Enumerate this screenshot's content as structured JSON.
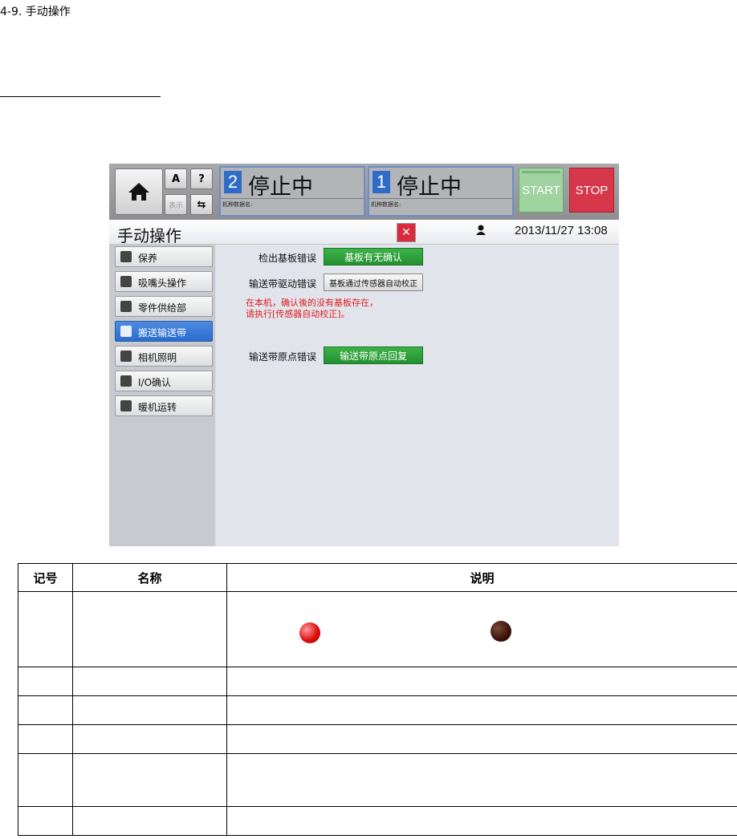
{
  "doc": {
    "heading": "4-9. 手动操作"
  },
  "hmi": {
    "home_icon": "home-icon",
    "buttons_small": [
      "A",
      "?",
      "表示",
      "⇆"
    ],
    "status": [
      {
        "num": "2",
        "text": "停止中",
        "sub": "机种数据名:"
      },
      {
        "num": "1",
        "text": "停止中",
        "sub": "机种数据名:"
      }
    ],
    "start_label": "START",
    "stop_label": "STOP",
    "page_title": "手动操作",
    "datetime": "2013/11/27 13:08",
    "sidebar": [
      {
        "label": "保养",
        "active": false
      },
      {
        "label": "吸嘴头操作",
        "active": false
      },
      {
        "label": "零件供给部",
        "active": false
      },
      {
        "label": "搬送输送带",
        "active": true
      },
      {
        "label": "相机照明",
        "active": false
      },
      {
        "label": "I/O确认",
        "active": false
      },
      {
        "label": "暖机运转",
        "active": false
      }
    ],
    "rows": {
      "r1_label": "检出基板错误",
      "r1_button": "基板有无确认",
      "r2_label": "输送带驱动错误",
      "r2_button": "基板通过传感器自动校正",
      "note_line1": "在本机，确认後的没有基板存在，",
      "note_line2": "请执行[传感器自动校正]。",
      "r3_label": "输送带原点错误",
      "r3_button": "输送带原点回复"
    }
  },
  "table": {
    "headers": [
      "记号",
      "名称",
      "说明"
    ]
  },
  "colors": {
    "accent_blue": "#2f6cc8",
    "start_green": "#9fd3a0",
    "stop_red": "#d6374a",
    "action_green": "#2aa13a",
    "note_red": "#e01c1c"
  }
}
